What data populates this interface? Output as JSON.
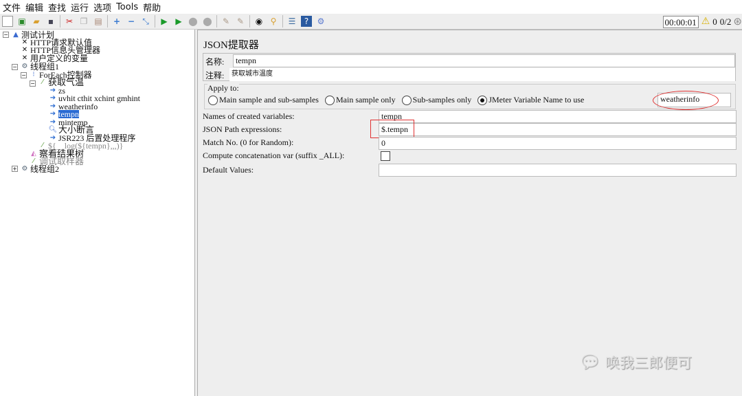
{
  "menu": [
    "文件",
    "编辑",
    "查找",
    "运行",
    "选项",
    "Tools",
    "帮助"
  ],
  "status": {
    "timer": "00:00:01",
    "warnings": "0",
    "threads": "0/2"
  },
  "tree": [
    {
      "label": "测试计划",
      "icon": "test-plan-icon"
    },
    {
      "label": "HTTP请求默认值",
      "icon": "config-icon"
    },
    {
      "label": "HTTP信息头管理器",
      "icon": "config-icon"
    },
    {
      "label": "用户定义的变量",
      "icon": "config-icon"
    },
    {
      "label": "线程组1",
      "icon": "thread-group-icon"
    },
    {
      "label": "ForEach控制器",
      "icon": "controller-icon"
    },
    {
      "label": "获取气温",
      "icon": "sampler-icon"
    },
    {
      "label": "zs",
      "icon": "post-processor-icon"
    },
    {
      "label": "uvhit cthit xchint gmhint",
      "icon": "post-processor-icon"
    },
    {
      "label": "weatherinfo",
      "icon": "post-processor-icon"
    },
    {
      "label": "tempn",
      "icon": "post-processor-icon"
    },
    {
      "label": "mintemp",
      "icon": "post-processor-icon"
    },
    {
      "label": "大小断言",
      "icon": "assertion-icon"
    },
    {
      "label": "JSR223 后置处理程序",
      "icon": "post-processor-icon"
    },
    {
      "label": "${__log(${tempn},,,)}",
      "icon": "sampler-icon"
    },
    {
      "label": "察看结果树",
      "icon": "listener-icon"
    },
    {
      "label": "调试取样器",
      "icon": "sampler-icon"
    },
    {
      "label": "线程组2",
      "icon": "thread-group-icon"
    }
  ],
  "panel": {
    "title": "JSON提取器",
    "name_label": "名称:",
    "name_value": "tempn",
    "comment_label": "注释:",
    "comment_value": "获取城市温度",
    "apply_to": "Apply to:",
    "radios": [
      "Main sample and sub-samples",
      "Main sample only",
      "Sub-samples only",
      "JMeter Variable Name to use"
    ],
    "selected_radio": 3,
    "var_name": "weatherinfo",
    "names_label": "Names of created variables:",
    "names_value": "tempn",
    "path_label": "JSON Path expressions:",
    "path_value": "$.tempn",
    "match_label": "Match No. (0 for Random):",
    "match_value": "0",
    "concat_label": "Compute concatenation var (suffix _ALL):",
    "concat_checked": false,
    "default_label": "Default Values:",
    "default_value": ""
  },
  "watermark": "唤我三郎便可"
}
